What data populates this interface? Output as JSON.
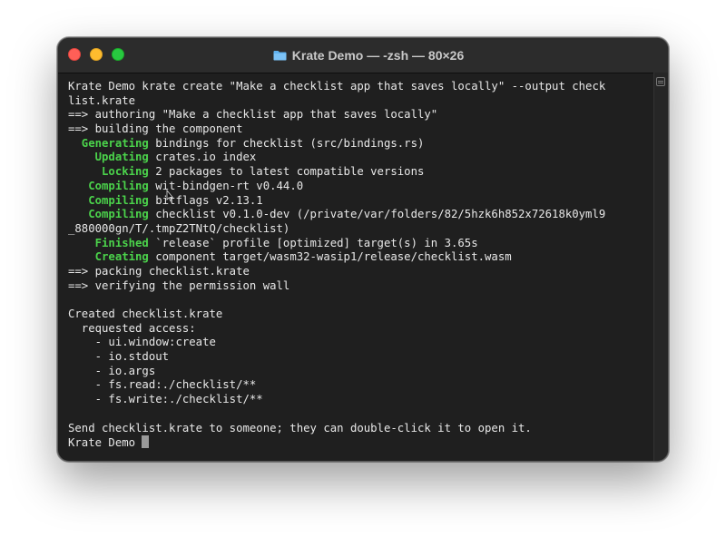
{
  "window": {
    "title": "Krate Demo — -zsh — 80×26",
    "icon": "folder-icon"
  },
  "terminal": {
    "lines": [
      [
        {
          "t": "Krate Demo krate create \"Make a checklist app that saves locally\" --output check"
        }
      ],
      [
        {
          "t": "list.krate"
        }
      ],
      [
        {
          "t": "==> authoring \"Make a checklist app that saves locally\""
        }
      ],
      [
        {
          "t": "==> building the component"
        }
      ],
      [
        {
          "t": "  Generating",
          "g": true
        },
        {
          "t": " bindings for checklist (src/bindings.rs)"
        }
      ],
      [
        {
          "t": "    Updating",
          "g": true
        },
        {
          "t": " crates.io index"
        }
      ],
      [
        {
          "t": "     Locking",
          "g": true
        },
        {
          "t": " 2 packages to latest compatible versions"
        }
      ],
      [
        {
          "t": "   Compiling",
          "g": true
        },
        {
          "t": " wit-bindgen-rt v0.44.0"
        }
      ],
      [
        {
          "t": "   Compiling",
          "g": true
        },
        {
          "t": " bitflags v2.13.1"
        }
      ],
      [
        {
          "t": "   Compiling",
          "g": true
        },
        {
          "t": " checklist v0.1.0-dev (/private/var/folders/82/5hzk6h852x72618k0yml9"
        }
      ],
      [
        {
          "t": "_880000gn/T/.tmpZ2TNtQ/checklist)"
        }
      ],
      [
        {
          "t": "    Finished",
          "g": true
        },
        {
          "t": " `release` profile [optimized] target(s) in 3.65s"
        }
      ],
      [
        {
          "t": "    Creating",
          "g": true
        },
        {
          "t": " component target/wasm32-wasip1/release/checklist.wasm"
        }
      ],
      [
        {
          "t": "==> packing checklist.krate"
        }
      ],
      [
        {
          "t": "==> verifying the permission wall"
        }
      ],
      [
        {
          "t": ""
        }
      ],
      [
        {
          "t": "Created checklist.krate"
        }
      ],
      [
        {
          "t": "  requested access:"
        }
      ],
      [
        {
          "t": "    - ui.window:create"
        }
      ],
      [
        {
          "t": "    - io.stdout"
        }
      ],
      [
        {
          "t": "    - io.args"
        }
      ],
      [
        {
          "t": "    - fs.read:./checklist/**"
        }
      ],
      [
        {
          "t": "    - fs.write:./checklist/**"
        }
      ],
      [
        {
          "t": ""
        }
      ],
      [
        {
          "t": "Send checklist.krate to someone; they can double-click it to open it."
        }
      ],
      [
        {
          "t": "Krate Demo "
        }
      ]
    ],
    "prompt_line_index": 25,
    "colors": {
      "background": "#1f1f1f",
      "text": "#e8e8e8",
      "status_green": "#4bd34b",
      "cursor": "#9a9a9a"
    }
  }
}
